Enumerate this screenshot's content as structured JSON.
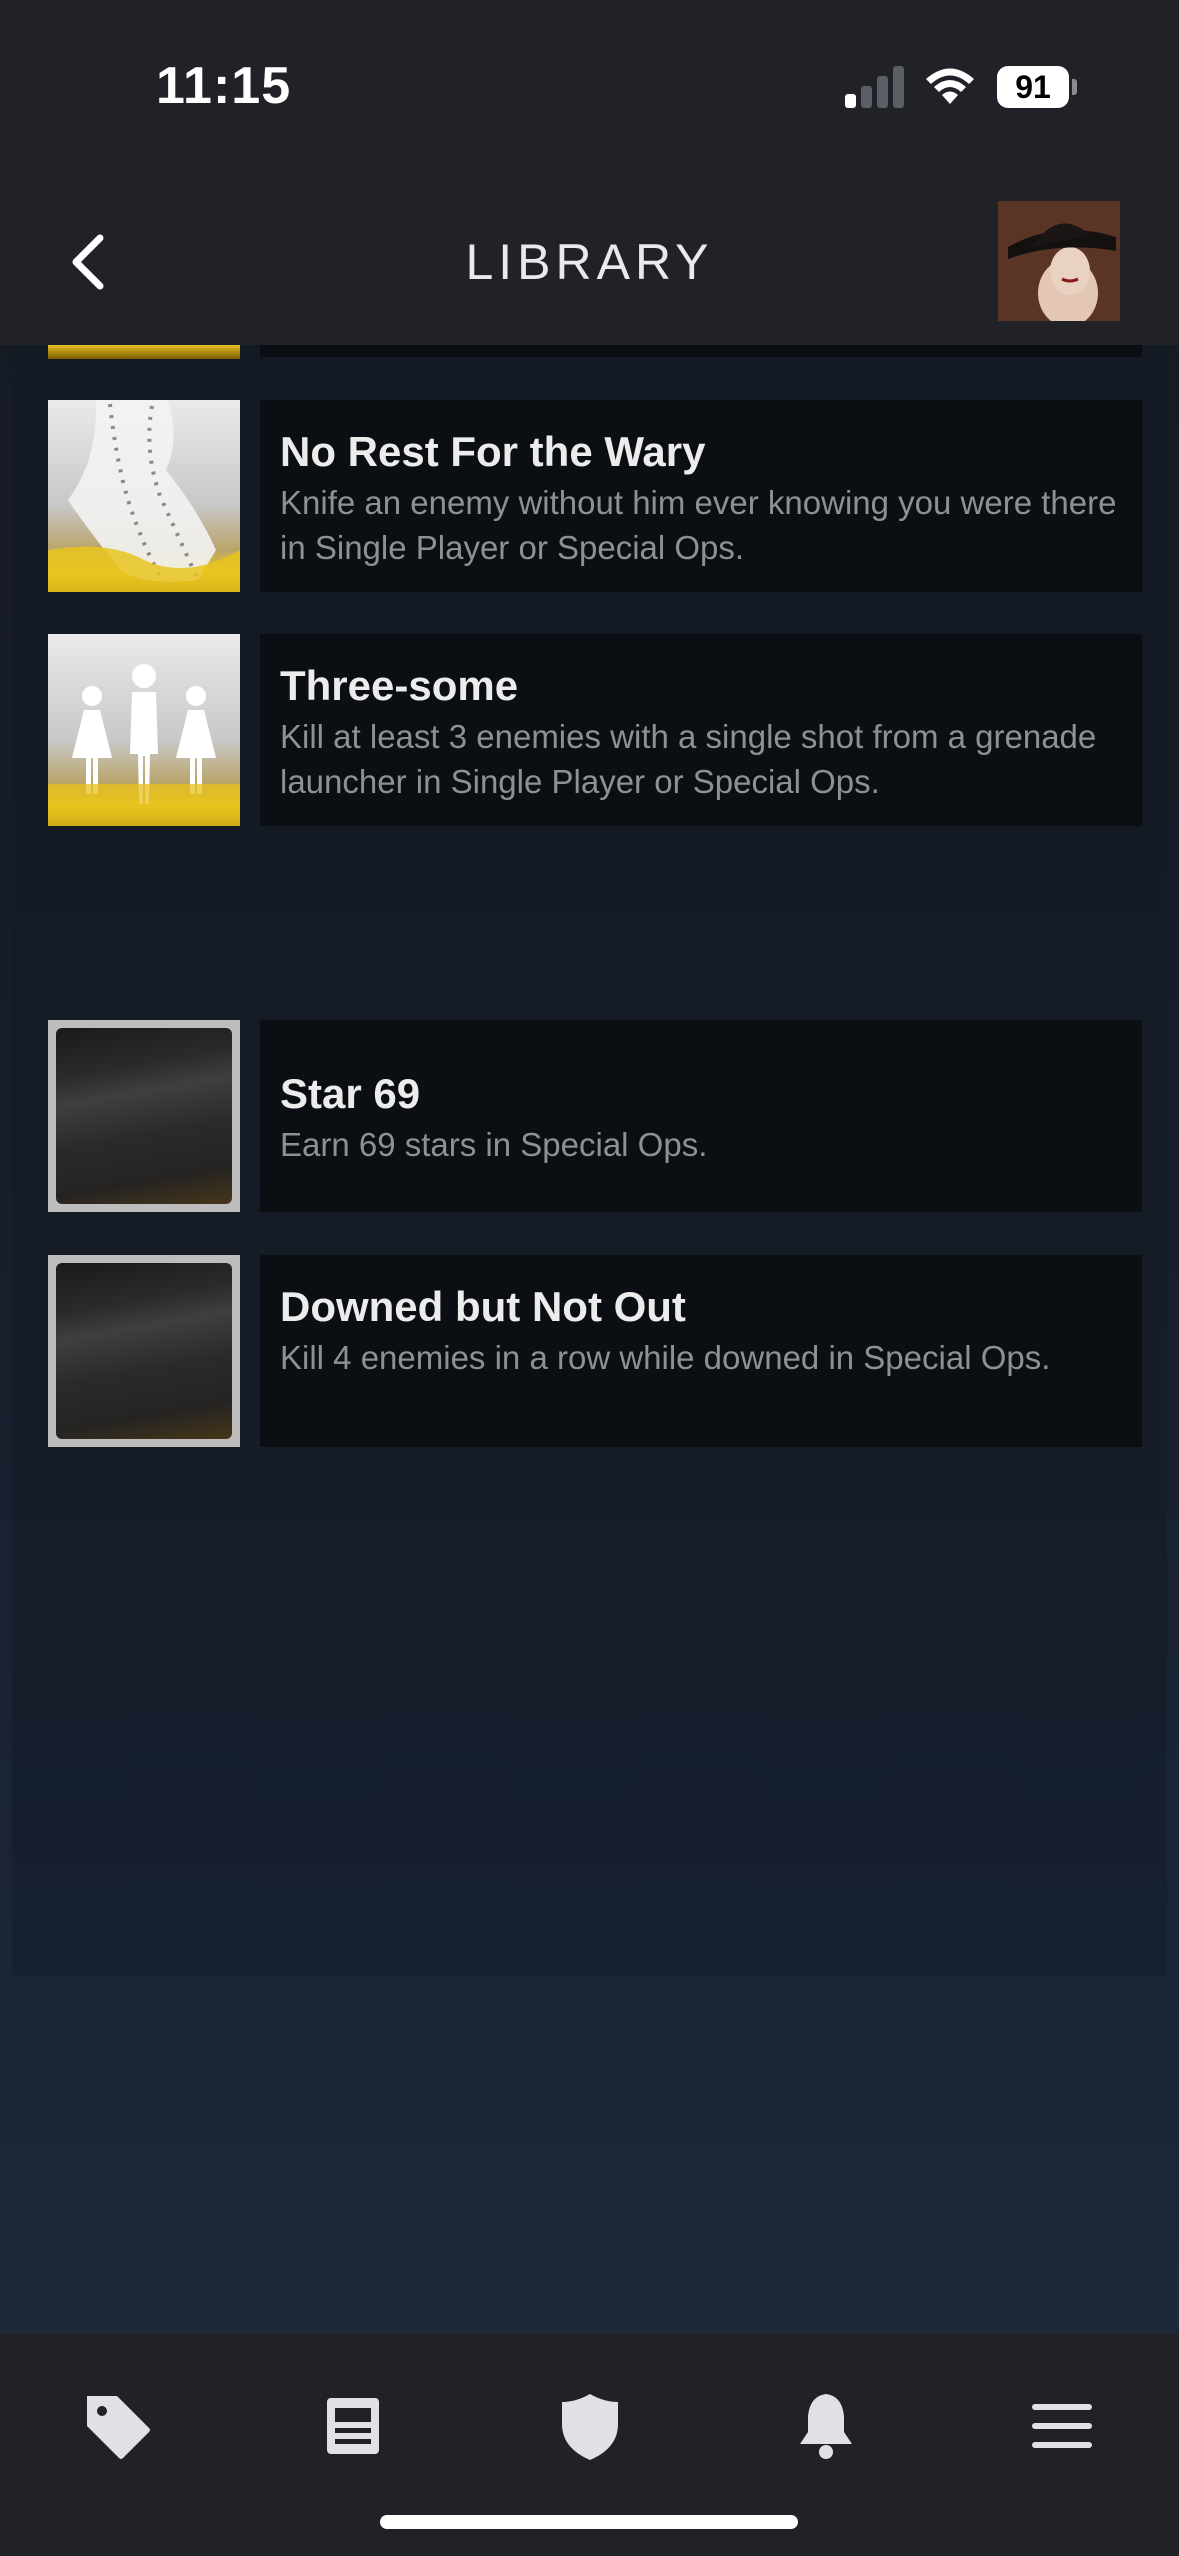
{
  "status_bar": {
    "time": "11:15",
    "battery_level": "91",
    "signal_bars_active": 1,
    "signal_bars_total": 4,
    "icons": [
      "cellular-signal-icon",
      "wifi-icon",
      "battery-icon"
    ]
  },
  "header": {
    "title": "LIBRARY",
    "back_icon": "chevron-left-icon",
    "avatar": "profile-avatar"
  },
  "achievements": [
    {
      "title": "No Rest For the Wary",
      "description": "Knife an enemy without him ever knowing you were there in Single Player or Special Ops.",
      "unlocked": true
    },
    {
      "title": "Three-some",
      "description": "Kill at least 3 enemies with a single shot from a grenade launcher in Single Player or Special Ops.",
      "unlocked": true
    },
    {
      "title": "Star 69",
      "description": "Earn 69 stars in Special Ops.",
      "unlocked": false
    },
    {
      "title": "Downed but Not Out",
      "description": "Kill 4 enemies in a row while downed in Special Ops.",
      "unlocked": false
    }
  ],
  "tab_bar": {
    "tabs": [
      "store-tag-icon",
      "news-icon",
      "guard-shield-icon",
      "notifications-bell-icon",
      "menu-icon"
    ]
  },
  "colors": {
    "chrome_background": "#202227",
    "card_background": "#0b0e13",
    "title_text": "#ececec",
    "description_text": "#8e9096",
    "gold_accent": "#e9c71f"
  }
}
